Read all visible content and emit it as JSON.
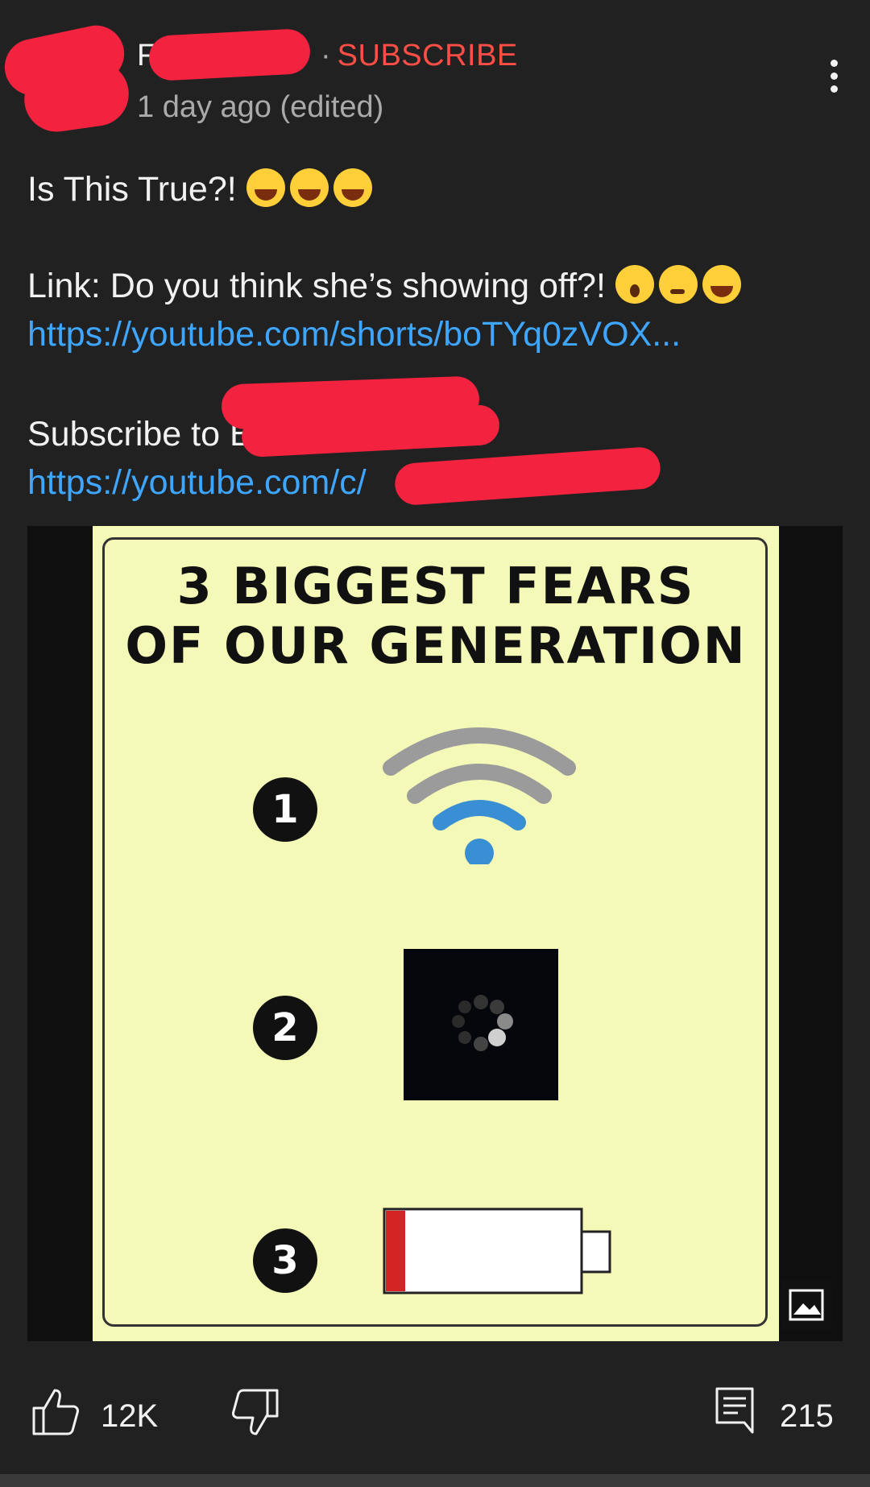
{
  "post": {
    "channel_name": "F          s",
    "separator": "·",
    "subscribe_label": "SUBSCRIBE",
    "timestamp": "1 day ago (edited)",
    "line1": "Is This True?!",
    "line2": "Link: Do you think she’s showing off?!",
    "link1": "https://youtube.com/shorts/boTYq0zVOX...",
    "subscribe_text": "Subscribe to B",
    "link2": "https://youtube.com/c/"
  },
  "meme": {
    "title_line1": "3 BIGGEST FEARS",
    "title_line2": "OF OUR GENERATION",
    "numbers": [
      "1",
      "2",
      "3"
    ],
    "icons": [
      "wifi-weak-icon",
      "loading-spinner-icon",
      "low-battery-icon"
    ]
  },
  "actions": {
    "like_count": "12K",
    "comment_count": "215"
  },
  "colors": {
    "background": "#212121",
    "link": "#3ea6ff",
    "subscribe": "#ff4e45",
    "redaction": "#f3223f",
    "meme_bg": "#f5f9b8"
  }
}
